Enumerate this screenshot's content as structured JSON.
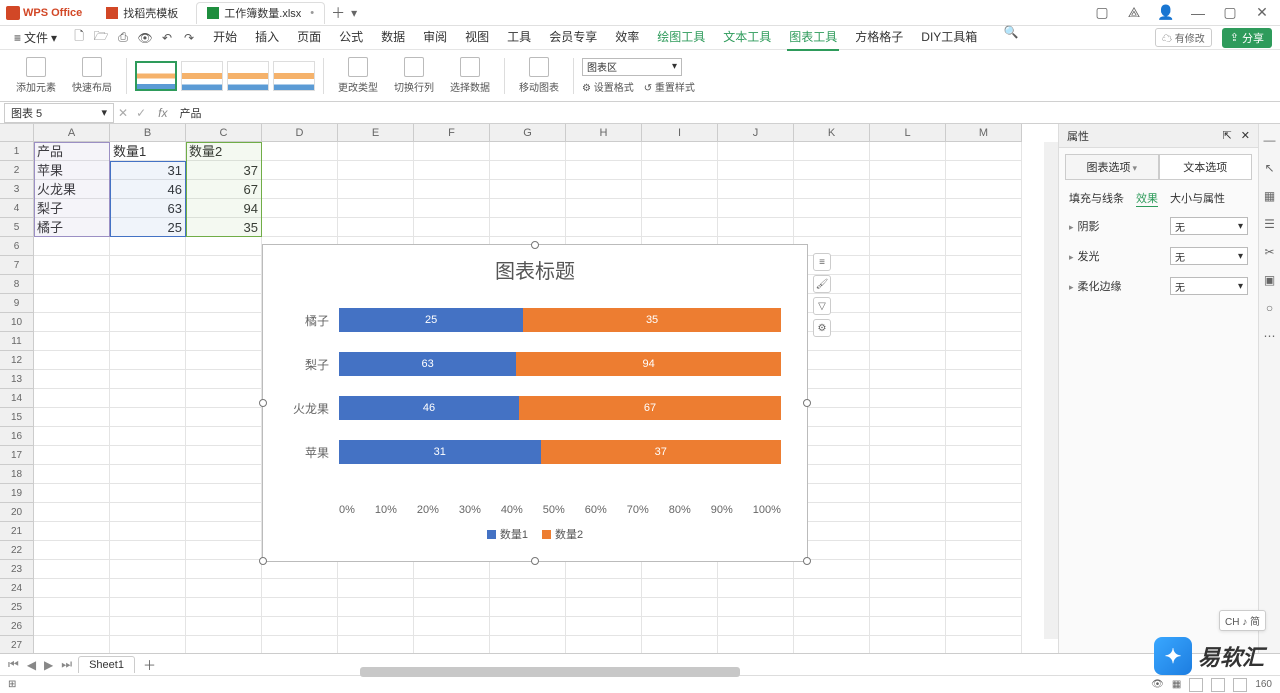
{
  "app": {
    "name": "WPS Office"
  },
  "tabs": [
    {
      "label": "找稻壳模板",
      "icon": "doc"
    },
    {
      "label": "工作簿数量.xlsx",
      "icon": "xls",
      "active": true,
      "dirty": "•"
    }
  ],
  "menubar": {
    "file": "文件",
    "items": [
      "开始",
      "插入",
      "页面",
      "公式",
      "数据",
      "审阅",
      "视图",
      "工具",
      "会员专享",
      "效率"
    ],
    "green": [
      "绘图工具",
      "文本工具",
      "图表工具",
      "方格格子",
      "DIY工具箱"
    ],
    "active": "图表工具",
    "modified": "有修改",
    "share": "分享"
  },
  "ribbon": {
    "add_elem": "添加元素",
    "quick_layout": "快速布局",
    "change_type": "更改类型",
    "switch_rc": "切换行列",
    "select_data": "选择数据",
    "move_chart": "移动图表",
    "area_select": "图表区",
    "set_format": "设置格式",
    "reset_style": "重置样式"
  },
  "fbar": {
    "name": "图表 5",
    "fx": "fx",
    "formula": "产品"
  },
  "columns": [
    "A",
    "B",
    "C",
    "D",
    "E",
    "F",
    "G",
    "H",
    "I",
    "J",
    "K",
    "L",
    "M"
  ],
  "rows": 27,
  "data": {
    "A1": "产品",
    "B1": "数量1",
    "C1": "数量2",
    "A2": "苹果",
    "B2": "31",
    "C2": "37",
    "A3": "火龙果",
    "B3": "46",
    "C3": "67",
    "A4": "梨子",
    "B4": "63",
    "C4": "94",
    "A5": "橘子",
    "B5": "25",
    "C5": "35"
  },
  "chart_data": {
    "type": "bar",
    "title": "图表标题",
    "categories": [
      "橘子",
      "梨子",
      "火龙果",
      "苹果"
    ],
    "series": [
      {
        "name": "数量1",
        "values": [
          25,
          63,
          46,
          31
        ],
        "color": "#4472c4"
      },
      {
        "name": "数量2",
        "values": [
          35,
          94,
          67,
          37
        ],
        "color": "#ed7d31"
      }
    ],
    "stacked_percent": true,
    "axis_ticks": [
      "0%",
      "10%",
      "20%",
      "30%",
      "40%",
      "50%",
      "60%",
      "70%",
      "80%",
      "90%",
      "100%"
    ],
    "legend": [
      "数量1",
      "数量2"
    ]
  },
  "props": {
    "title": "属性",
    "tab_chart": "图表选项",
    "tab_text": "文本选项",
    "sub": [
      "填充与线条",
      "效果",
      "大小与属性"
    ],
    "sub_active": "效果",
    "shadow": "阴影",
    "glow": "发光",
    "soft": "柔化边缘",
    "none": "无"
  },
  "sheet": {
    "name": "Sheet1"
  },
  "status": {
    "zoom": "160"
  },
  "ime": "CH ♪ 简",
  "watermark": "易软汇"
}
